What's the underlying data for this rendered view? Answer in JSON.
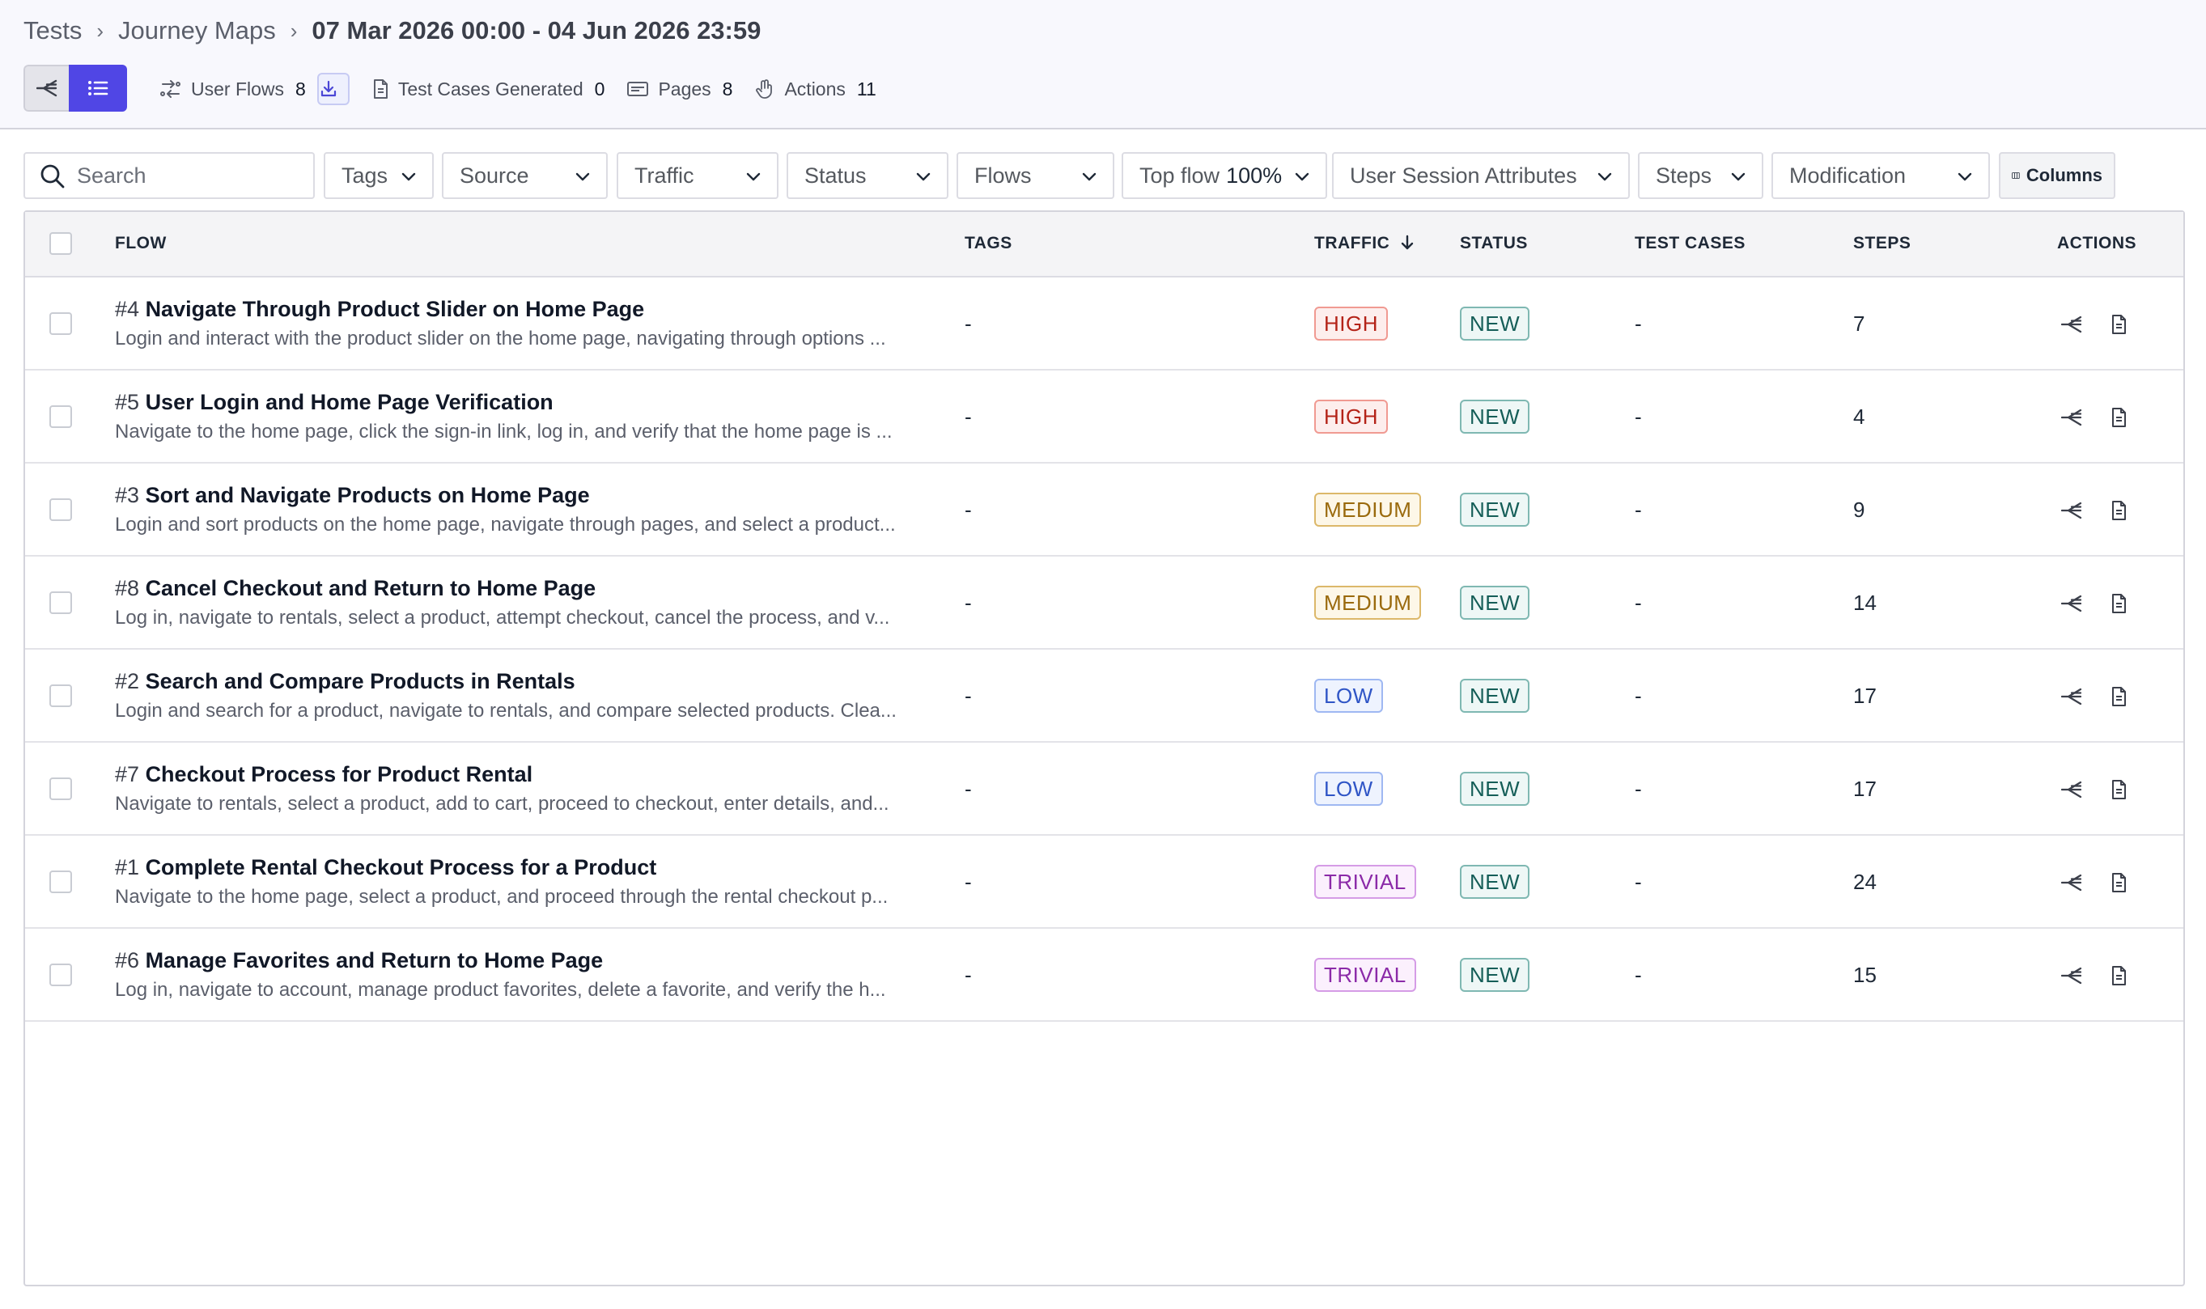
{
  "breadcrumb": {
    "items": [
      "Tests",
      "Journey Maps"
    ],
    "current": "07 Mar 2026 00:00 - 04 Jun 2026 23:59"
  },
  "stats": {
    "user_flows_label": "User Flows",
    "user_flows_value": "8",
    "test_cases_label": "Test Cases Generated",
    "test_cases_value": "0",
    "pages_label": "Pages",
    "pages_value": "8",
    "actions_label": "Actions",
    "actions_value": "11"
  },
  "filters": {
    "search_placeholder": "Search",
    "tags": "Tags",
    "source": "Source",
    "traffic": "Traffic",
    "status": "Status",
    "flows": "Flows",
    "top_flow_label": "Top flow",
    "top_flow_value": "100%",
    "user_session_attributes": "User Session Attributes",
    "steps": "Steps",
    "modification": "Modification",
    "columns": "Columns"
  },
  "table": {
    "headers": {
      "flow": "FLOW",
      "tags": "TAGS",
      "traffic": "TRAFFIC",
      "status": "STATUS",
      "test_cases": "TEST CASES",
      "steps": "STEPS",
      "actions": "ACTIONS"
    },
    "rows": [
      {
        "num": "#4",
        "title": "Navigate Through Product Slider on Home Page",
        "desc": "Login and interact with the product slider on the home page, navigating through options ...",
        "tags": "-",
        "traffic": "HIGH",
        "status": "NEW",
        "test_cases": "-",
        "steps": "7"
      },
      {
        "num": "#5",
        "title": "User Login and Home Page Verification",
        "desc": "Navigate to the home page, click the sign-in link, log in, and verify that the home page is ...",
        "tags": "-",
        "traffic": "HIGH",
        "status": "NEW",
        "test_cases": "-",
        "steps": "4"
      },
      {
        "num": "#3",
        "title": "Sort and Navigate Products on Home Page",
        "desc": "Login and sort products on the home page, navigate through pages, and select a product...",
        "tags": "-",
        "traffic": "MEDIUM",
        "status": "NEW",
        "test_cases": "-",
        "steps": "9"
      },
      {
        "num": "#8",
        "title": "Cancel Checkout and Return to Home Page",
        "desc": "Log in, navigate to rentals, select a product, attempt checkout, cancel the process, and v...",
        "tags": "-",
        "traffic": "MEDIUM",
        "status": "NEW",
        "test_cases": "-",
        "steps": "14"
      },
      {
        "num": "#2",
        "title": "Search and Compare Products in Rentals",
        "desc": "Login and search for a product, navigate to rentals, and compare selected products. Clea...",
        "tags": "-",
        "traffic": "LOW",
        "status": "NEW",
        "test_cases": "-",
        "steps": "17"
      },
      {
        "num": "#7",
        "title": "Checkout Process for Product Rental",
        "desc": "Navigate to rentals, select a product, add to cart, proceed to checkout, enter details, and...",
        "tags": "-",
        "traffic": "LOW",
        "status": "NEW",
        "test_cases": "-",
        "steps": "17"
      },
      {
        "num": "#1",
        "title": "Complete Rental Checkout Process for a Product",
        "desc": "Navigate to the home page, select a product, and proceed through the rental checkout p...",
        "tags": "-",
        "traffic": "TRIVIAL",
        "status": "NEW",
        "test_cases": "-",
        "steps": "24"
      },
      {
        "num": "#6",
        "title": "Manage Favorites and Return to Home Page",
        "desc": "Log in, navigate to account, manage product favorites, delete a favorite, and verify the h...",
        "tags": "-",
        "traffic": "TRIVIAL",
        "status": "NEW",
        "test_cases": "-",
        "steps": "15"
      }
    ]
  },
  "colors": {
    "accent": "#5046e5",
    "high": "#b42318",
    "medium": "#9a6a0d",
    "low": "#2f55c6",
    "trivial": "#8b2aa8",
    "new": "#155e58"
  },
  "icons": [
    "flow-map-icon",
    "list-icon",
    "user-flows-icon",
    "download-icon",
    "document-icon",
    "pages-icon",
    "hand-icon",
    "search-icon",
    "chevron-down-icon",
    "columns-icon",
    "arrow-down-icon"
  ]
}
